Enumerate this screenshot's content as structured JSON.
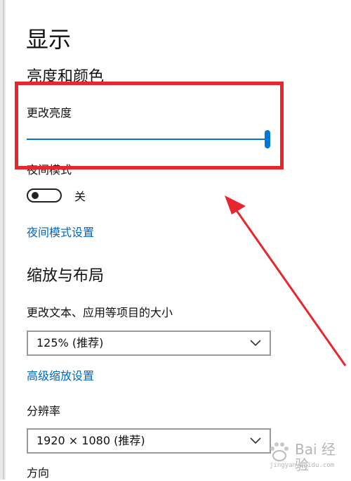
{
  "page": {
    "title": "显示"
  },
  "brightness_color": {
    "heading": "亮度和颜色",
    "change_brightness_label": "更改亮度",
    "brightness_level": 1.0,
    "night_light_label": "夜间模式",
    "night_light_state": "关",
    "night_light_settings_link": "夜间模式设置"
  },
  "scale_layout": {
    "heading": "缩放与布局",
    "scale_label": "更改文本、应用等项目的大小",
    "scale_value": "125% (推荐)",
    "advanced_scaling_link": "高级缩放设置",
    "resolution_label": "分辨率",
    "resolution_value": "1920 × 1080 (推荐)",
    "orientation_label": "方向"
  },
  "annotation": {
    "box_color": "#e8262d",
    "arrow_color": "#e8262d"
  },
  "watermark": {
    "brand": "Bai 经验",
    "url": "jingyan.baidu.com"
  },
  "colors": {
    "accent": "#0078d7",
    "link": "#0067c0"
  }
}
